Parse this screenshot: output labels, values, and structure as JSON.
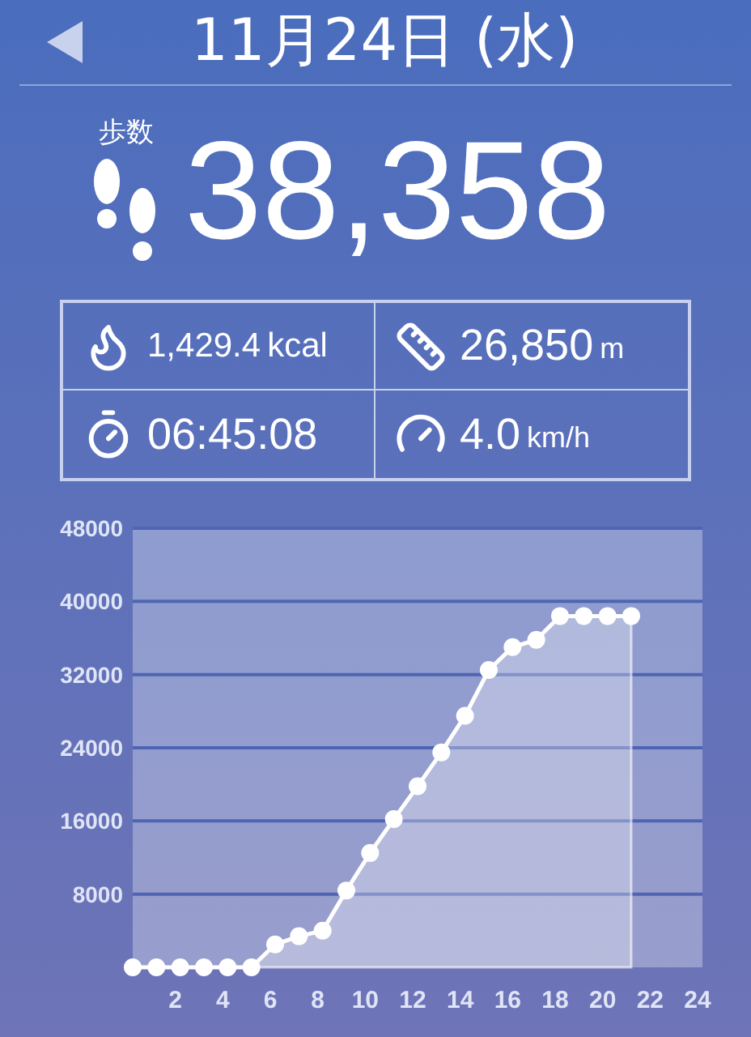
{
  "header": {
    "date": "11月24日 (水)"
  },
  "steps": {
    "label": "歩数",
    "value": "38,358"
  },
  "stats": [
    {
      "kind": "calories",
      "value": "1,429.4",
      "unit": "kcal"
    },
    {
      "kind": "distance",
      "value": "26,850",
      "unit": "m"
    },
    {
      "kind": "time",
      "value": "06:45:08"
    },
    {
      "kind": "speed",
      "value": "4.0",
      "unit": "km/h"
    }
  ],
  "chart": {
    "chart_data": {
      "type": "area",
      "x": [
        0,
        1,
        2,
        3,
        4,
        5,
        6,
        7,
        8,
        9,
        10,
        11,
        12,
        13,
        14,
        15,
        16,
        17,
        18,
        19,
        20,
        21
      ],
      "values": [
        0,
        0,
        0,
        0,
        0,
        0,
        2500,
        3400,
        4000,
        8400,
        12500,
        16200,
        19800,
        23500,
        27500,
        32500,
        35000,
        35800,
        38400,
        38400,
        38400,
        38400
      ],
      "grid": true,
      "xlim": [
        0,
        24
      ],
      "ylim": [
        0,
        48000
      ],
      "xticks": [
        2,
        4,
        6,
        8,
        10,
        12,
        14,
        16,
        18,
        20,
        22,
        24
      ],
      "yticks": [
        8000,
        16000,
        24000,
        32000,
        40000,
        48000
      ]
    }
  }
}
